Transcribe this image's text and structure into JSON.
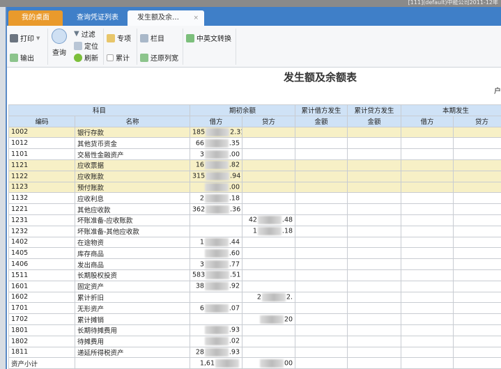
{
  "window": {
    "title_fragment": "[111](default)中能公司2011-12年"
  },
  "tabs": [
    {
      "label": "我的桌面"
    },
    {
      "label": "查询凭证列表"
    },
    {
      "label": "发生额及余…",
      "close": "×"
    }
  ],
  "toolbar": {
    "print": "打印",
    "export": "输出",
    "query": "查询",
    "filter": "过滤",
    "locate": "定位",
    "refresh": "刷新",
    "special": "专项",
    "cumulative": "累计",
    "columns": "栏目",
    "restore_width": "还原列宽",
    "cn_en": "中英文转换"
  },
  "report": {
    "title": "发生额及余额表",
    "unit_fragment": "户"
  },
  "table": {
    "group_headers": [
      "科目",
      "期初余额",
      "累计借方发生",
      "累计贷方发生",
      "本期发生"
    ],
    "sub_headers": [
      "编码",
      "名称",
      "借方",
      "贷方",
      "金额",
      "金额",
      "借方",
      "贷方"
    ],
    "rows": [
      {
        "code": "1002",
        "name": "银行存款",
        "dl": "185",
        "dr": "2.31",
        "cl": "",
        "cr": "",
        "hl": true
      },
      {
        "code": "1012",
        "name": "其他货币资金",
        "dl": "66",
        "dr": ".35",
        "cl": "",
        "cr": ""
      },
      {
        "code": "1101",
        "name": "交易性金融资产",
        "dl": "3",
        "dr": ".00",
        "cl": "",
        "cr": ""
      },
      {
        "code": "1121",
        "name": "应收票据",
        "dl": "16",
        "dr": ".82",
        "cl": "",
        "cr": "",
        "hl": true
      },
      {
        "code": "1122",
        "name": "应收账款",
        "dl": "315",
        "dr": ".94",
        "cl": "",
        "cr": "",
        "hl": true
      },
      {
        "code": "1123",
        "name": "预付账款",
        "dl": "",
        "dr": ".00",
        "cl": "",
        "cr": "",
        "hl": true
      },
      {
        "code": "1132",
        "name": "应收利息",
        "dl": "2",
        "dr": ".18",
        "cl": "",
        "cr": ""
      },
      {
        "code": "1221",
        "name": "其他应收款",
        "dl": "362",
        "dr": ".36",
        "cl": "",
        "cr": ""
      },
      {
        "code": "1231",
        "name": "坏账准备-应收账款",
        "dl": "",
        "dr": "",
        "cl": "42",
        "cr": ".48"
      },
      {
        "code": "1232",
        "name": "坏账准备-其他应收款",
        "dl": "",
        "dr": "",
        "cl": "1",
        "cr": ".18"
      },
      {
        "code": "1402",
        "name": "在途物资",
        "dl": "1",
        "dr": ".44",
        "cl": "",
        "cr": ""
      },
      {
        "code": "1405",
        "name": "库存商品",
        "dl": "",
        "dr": ".60",
        "cl": "",
        "cr": ""
      },
      {
        "code": "1406",
        "name": "发出商品",
        "dl": "3",
        "dr": ".77",
        "cl": "",
        "cr": ""
      },
      {
        "code": "1511",
        "name": "长期股权投资",
        "dl": "583",
        "dr": ".51",
        "cl": "",
        "cr": ""
      },
      {
        "code": "1601",
        "name": "固定资产",
        "dl": "38",
        "dr": ".92",
        "cl": "",
        "cr": ""
      },
      {
        "code": "1602",
        "name": "累计折旧",
        "dl": "",
        "dr": "",
        "cl": "2",
        "cr": "2."
      },
      {
        "code": "1701",
        "name": "无形资产",
        "dl": "6",
        "dr": ".07",
        "cl": "",
        "cr": ""
      },
      {
        "code": "1702",
        "name": "累计摊销",
        "dl": "",
        "dr": "",
        "cl": "",
        "cr": "20"
      },
      {
        "code": "1801",
        "name": "长期待摊费用",
        "dl": "",
        "dr": ".93",
        "cl": "",
        "cr": ""
      },
      {
        "code": "1802",
        "name": "待摊费用",
        "dl": "",
        "dr": ".02",
        "cl": "",
        "cr": ""
      },
      {
        "code": "1811",
        "name": "递延所得税资产",
        "dl": "28",
        "dr": ".93",
        "cl": "",
        "cr": ""
      },
      {
        "code": "资产小计",
        "name": "",
        "dl": "1,61",
        "dr": "",
        "cl": "",
        "cr": "00"
      }
    ]
  }
}
